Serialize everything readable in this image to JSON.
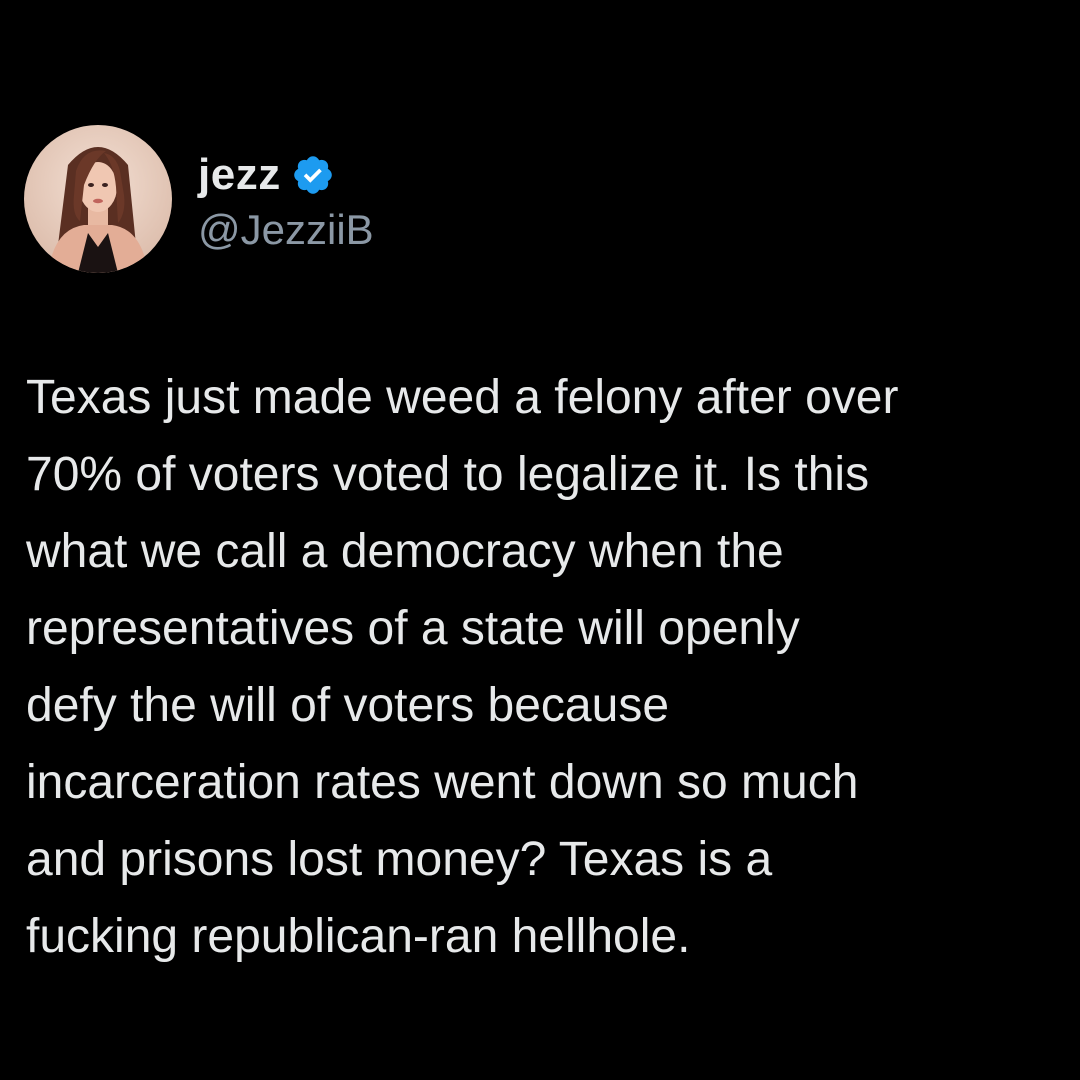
{
  "colors": {
    "background": "#000000",
    "text": "#e7e9ea",
    "handle": "#8b98a5",
    "verified_badge": "#1d9bf0"
  },
  "author": {
    "display_name": "jezz",
    "handle": "@JezziiB",
    "verified": true,
    "avatar_icon": "profile-photo",
    "badge_icon": "verified-badge-icon"
  },
  "tweet": {
    "text": "Texas just made weed a felony after over\n70% of voters voted to legalize it. Is this\nwhat we call a democracy when the\nrepresentatives of a state will openly\ndefy the will of voters because\nincarceration rates went down so much\nand prisons lost money? Texas is a\nfucking republican-ran hellhole."
  }
}
